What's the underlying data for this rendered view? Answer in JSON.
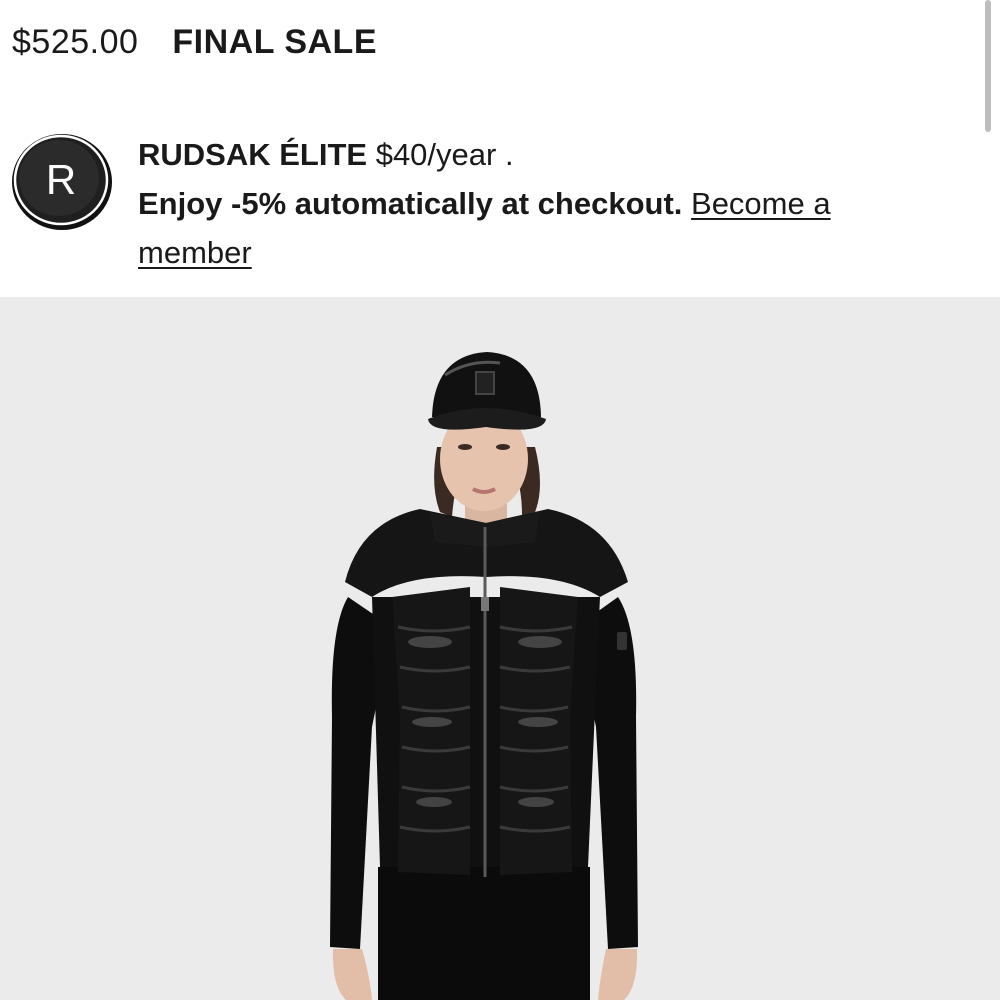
{
  "product": {
    "price": "$525.00",
    "sale_tag": "FINAL SALE"
  },
  "membership": {
    "logo_letter": "R",
    "name": "RUDSAK ÉLITE",
    "price": "$40/year .",
    "benefit": "Enjoy -5% automatically at checkout.",
    "link_label": "Become a member"
  },
  "image": {
    "background": "#ebebeb",
    "cap_logo_letter": "R",
    "icon": "product-photo"
  },
  "colors": {
    "text": "#1a1a1a",
    "image_background": "#ebebeb",
    "garment": "#0d0d0d"
  }
}
